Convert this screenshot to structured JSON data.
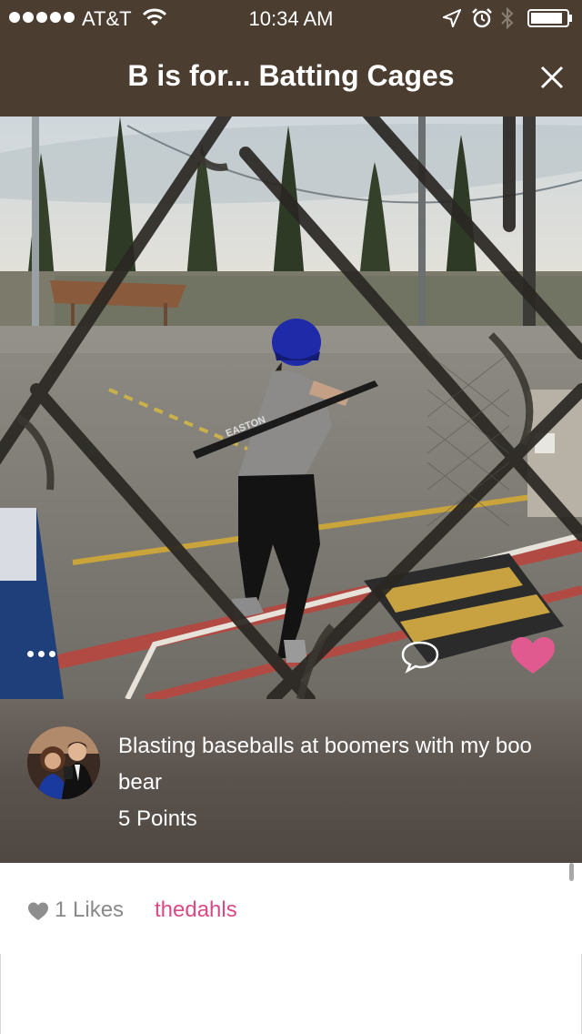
{
  "status_bar": {
    "carrier": "AT&T",
    "time": "10:34 AM",
    "signal_bars": 5
  },
  "nav": {
    "title": "B is for... Batting Cages",
    "close_icon": "close-icon"
  },
  "photo": {
    "bat_brand": "EASTON"
  },
  "post": {
    "caption": "Blasting baseballs at boomers with my boo bear",
    "points": "5 Points"
  },
  "likes": {
    "count_label": "1 Likes",
    "username": "thedahls"
  },
  "colors": {
    "nav_background": "#4b3e31",
    "heart_pink": "#e05a8f",
    "username_pink": "#d84a86"
  },
  "icons": [
    "signal-icon",
    "wifi-icon",
    "location-icon",
    "alarm-icon",
    "bluetooth-icon",
    "battery-icon",
    "close-icon",
    "more-icon",
    "comment-icon",
    "heart-icon"
  ]
}
